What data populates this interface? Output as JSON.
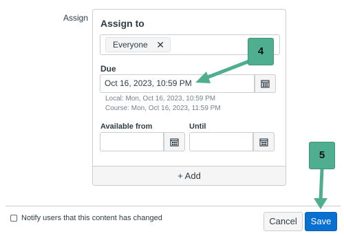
{
  "assign": {
    "label": "Assign",
    "card_title": "Assign to",
    "tag_label": "Everyone",
    "tag_remove": "✕"
  },
  "due": {
    "label": "Due",
    "value": "Oct 16, 2023, 10:59 PM",
    "local": "Local: Mon, Oct 16, 2023, 10:59 PM",
    "course": "Course: Mon, Oct 16, 2023, 11:59 PM"
  },
  "availability": {
    "from_label": "Available from",
    "until_label": "Until",
    "from_value": "",
    "until_value": ""
  },
  "add_label": "+ Add",
  "footer": {
    "notify_label": "Notify users that this content has changed",
    "cancel_label": "Cancel",
    "save_label": "Save"
  },
  "annotations": {
    "step_4": "4",
    "step_5": "5"
  },
  "colors": {
    "save_button": "#0770d1",
    "annotation": "#4fae8f"
  }
}
